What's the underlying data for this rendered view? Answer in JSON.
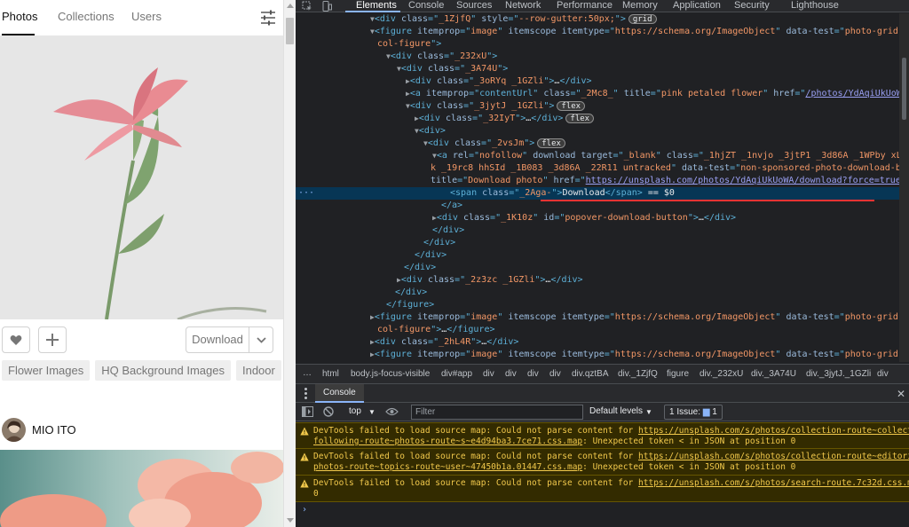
{
  "page": {
    "tabs": [
      "Photos",
      "Collections",
      "Users"
    ],
    "download_label": "Download",
    "tags": [
      "Flower Images",
      "HQ Background Images",
      "Indoor"
    ],
    "author": "MIO ITO"
  },
  "devtools": {
    "tabs": [
      "Elements",
      "Console",
      "Sources",
      "Network",
      "Performance",
      "Memory",
      "Application",
      "Security",
      "Lighthouse"
    ],
    "tree": {
      "l1": {
        "tag": "div",
        "class": "_1ZjfQ",
        "style": "--row-gutter:50px;",
        "badge": "grid"
      },
      "l2a": {
        "itemprop": "image",
        "itemtype": "https://schema.org/ImageObject",
        "datatest": "photo-grid-single-"
      },
      "l2b": "col-figure",
      "l3": "_232xU",
      "l4": "_3A74U",
      "l5": "_3oRYq _1GZli",
      "l6": {
        "title": "pink petaled flower",
        "href": "/photos/YdAqiUkUoWA",
        "class": "_2Mc8_"
      },
      "l7": "_3jytJ _1GZli",
      "l8": "_32IyT",
      "l10": "_2vsJm",
      "l11a": {
        "rel": "nofollow",
        "target": "_blank",
        "class": "_1hjZT _1nvjo _3jtP1 _3d86A _1WPby xLon9 Onk5"
      },
      "l11b": {
        "class": "k _19rc8 hhSId _1B083 _3d86A _22R11 untracked",
        "datatest": "non-sponsored-photo-download-button"
      },
      "l11c": {
        "title": "Download photo",
        "href": "https://unsplash.com/photos/YdAqiUkUoWA/download?force=true"
      },
      "l12": {
        "class": "_2Aga-",
        "text": "Download",
        "eq": "== $0"
      },
      "l14": {
        "class": "_1K10z",
        "id": "popover-download-button"
      },
      "l19": "_2z3zc _1GZli",
      "l22a": {
        "itemprop": "image",
        "itemtype": "https://schema.org/ImageObject",
        "datatest": "photo-grid-single-"
      },
      "l22b": "col-figure",
      "l23": "_2hL4R",
      "l24": {
        "itemprop": "image",
        "itemtype": "https://schema.org/ImageObject",
        "datatest": "photo-grid-single-"
      },
      "badges": {
        "flex": "flex"
      }
    },
    "breadcrumbs": [
      "html",
      "body.js-focus-visible",
      "div#app",
      "div",
      "div",
      "div",
      "div",
      "div.qztBA",
      "div._1ZjfQ",
      "figure",
      "div._232xU",
      "div._3A74U",
      "div._3jytJ._1GZli",
      "div"
    ],
    "drawer": {
      "tab": "Console"
    },
    "console_bar": {
      "context": "top",
      "filter_placeholder": "Filter",
      "levels": "Default levels",
      "issues_label": "1 Issue:",
      "issues_count": "1"
    },
    "warnings": [
      {
        "pre": "DevTools failed to load source map: Could not parse content for ",
        "url": "https://unsplash.com/s/photos/collection-route~collections",
        "l2url": "following-route~photos-route~s~e4d94ba3.7ce71.css.map",
        "l2rest": ": Unexpected token < in JSON at position 0"
      },
      {
        "pre": "DevTools failed to load source map: Could not parse content for ",
        "url": "https://unsplash.com/s/photos/collection-route~editorial-r",
        "l2url": "photos-route~topics-route~user~47450b1a.01447.css.map",
        "l2rest": ": Unexpected token < in JSON at position 0"
      },
      {
        "pre": "DevTools failed to load source map: Could not parse content for ",
        "url": "https://unsplash.com/s/photos/search-route.7c32d.css.map",
        "tail": ":",
        "l2rest": "0"
      }
    ],
    "prompt": "›"
  },
  "colors": {
    "selection": "#073655",
    "warning_bg": "#332b00",
    "warning_text": "#f2c94c",
    "accent": "#8ab4f8"
  }
}
